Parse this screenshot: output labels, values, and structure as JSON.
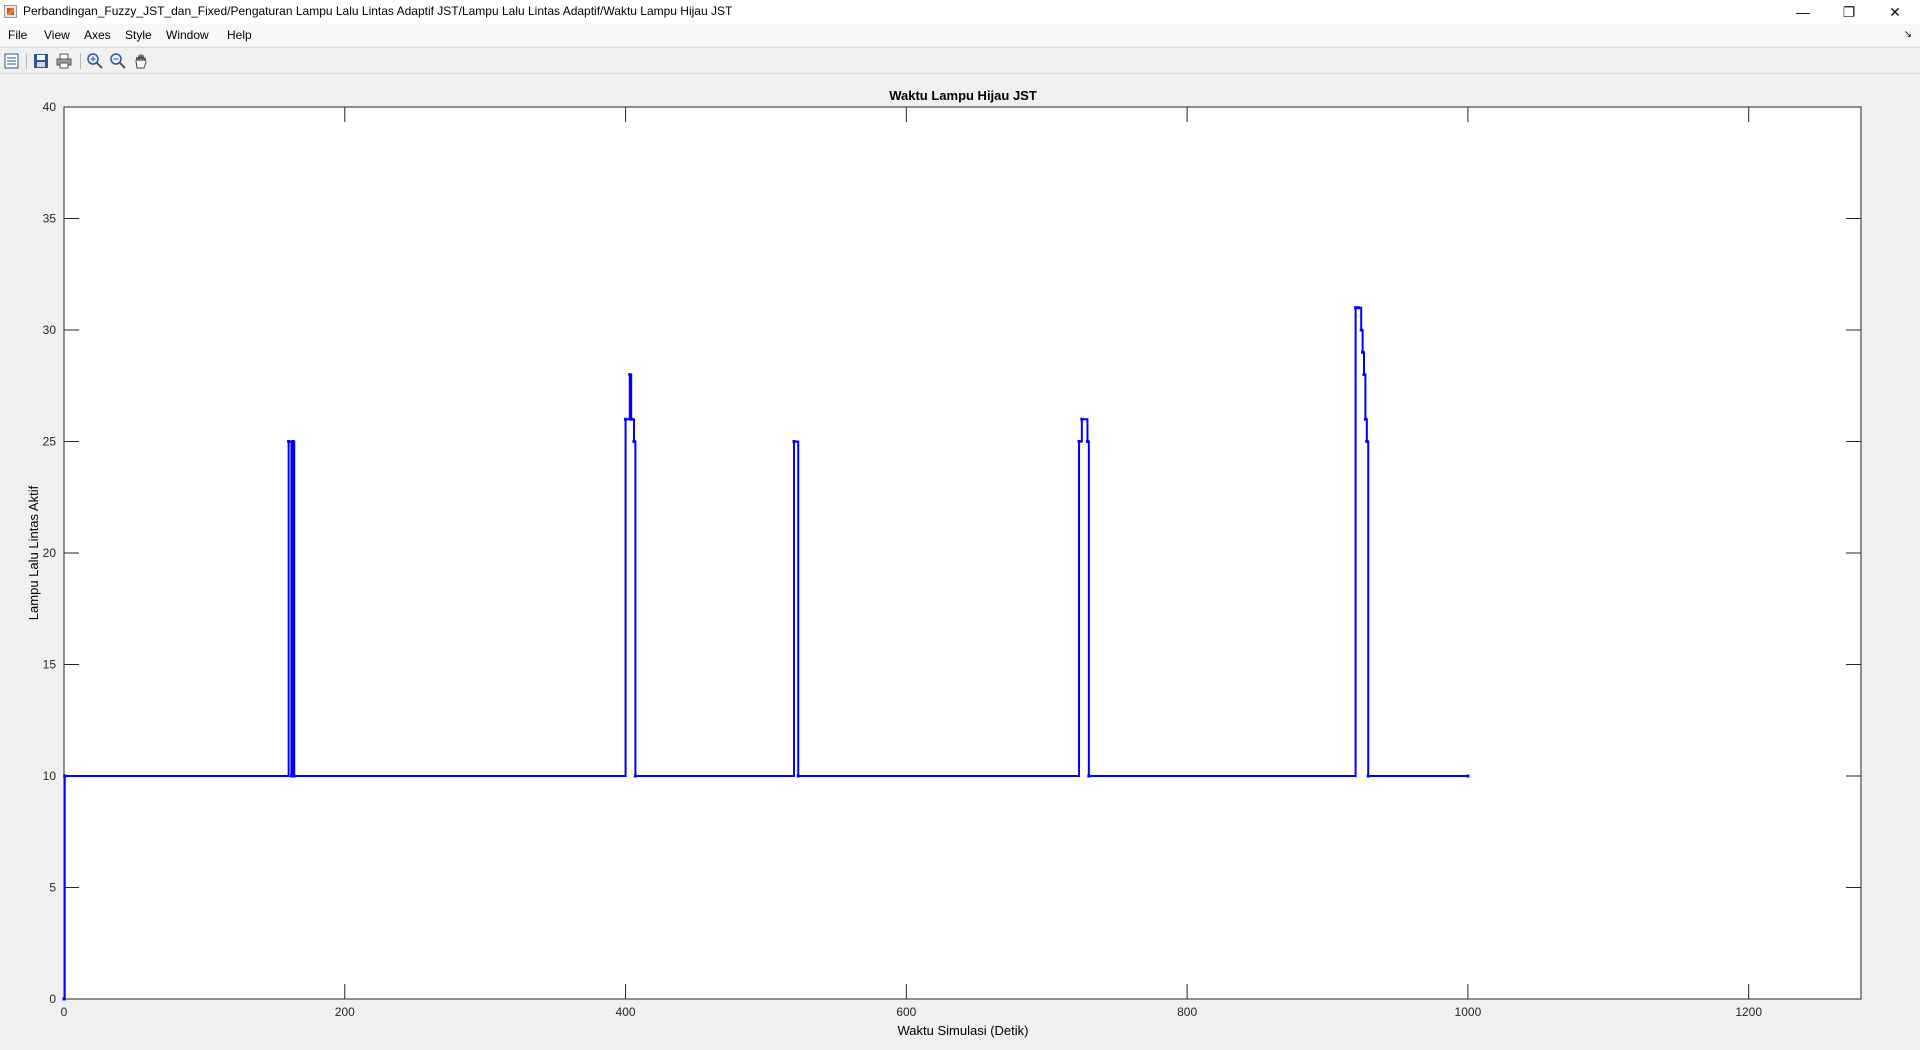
{
  "window": {
    "title": "Perbandingan_Fuzzy_JST_dan_Fixed/Pengaturan Lampu  Lalu Lintas Adaptif JST/Lampu Lalu Lintas Adaptif/Waktu Lampu Hijau JST",
    "minimize_glyph": "—",
    "maximize_glyph": "❐",
    "close_glyph": "✕"
  },
  "menu": {
    "file": "File",
    "view": "View",
    "axes": "Axes",
    "style": "Style",
    "window": "Window",
    "help": "Help"
  },
  "toolbar": {
    "icons": [
      "parameters-icon",
      "save-icon",
      "print-icon",
      "zoom-in-icon",
      "zoom-out-icon",
      "pan-icon"
    ]
  },
  "colors": {
    "line": "#0000ff",
    "grid": "#dcdcdc",
    "axes_bg": "#ffffff"
  },
  "chart_data": {
    "type": "line",
    "title": "Waktu Lampu Hijau JST",
    "xlabel": "Waktu Simulasi (Detik)",
    "ylabel": "Lampu Lalu Lintas Aktif",
    "xlim": [
      0,
      1280
    ],
    "ylim": [
      0,
      40
    ],
    "xticks": [
      0,
      200,
      400,
      600,
      800,
      1000,
      1200
    ],
    "yticks": [
      0,
      5,
      10,
      15,
      20,
      25,
      30,
      35,
      40
    ],
    "grid": true,
    "series": [
      {
        "style": "stairs",
        "x": [
          0,
          0.5,
          160,
          162,
          163,
          164,
          400,
          403,
          404,
          406,
          407,
          520,
          523,
          723,
          725,
          729,
          730,
          920,
          922,
          924,
          925,
          926,
          927,
          928,
          929,
          1000
        ],
        "y": [
          0,
          10,
          25,
          10,
          25,
          10,
          26,
          28,
          26,
          25,
          10,
          25,
          10,
          25,
          26,
          25,
          10,
          31,
          31,
          30,
          29,
          28,
          26,
          25,
          10,
          10
        ]
      }
    ]
  }
}
